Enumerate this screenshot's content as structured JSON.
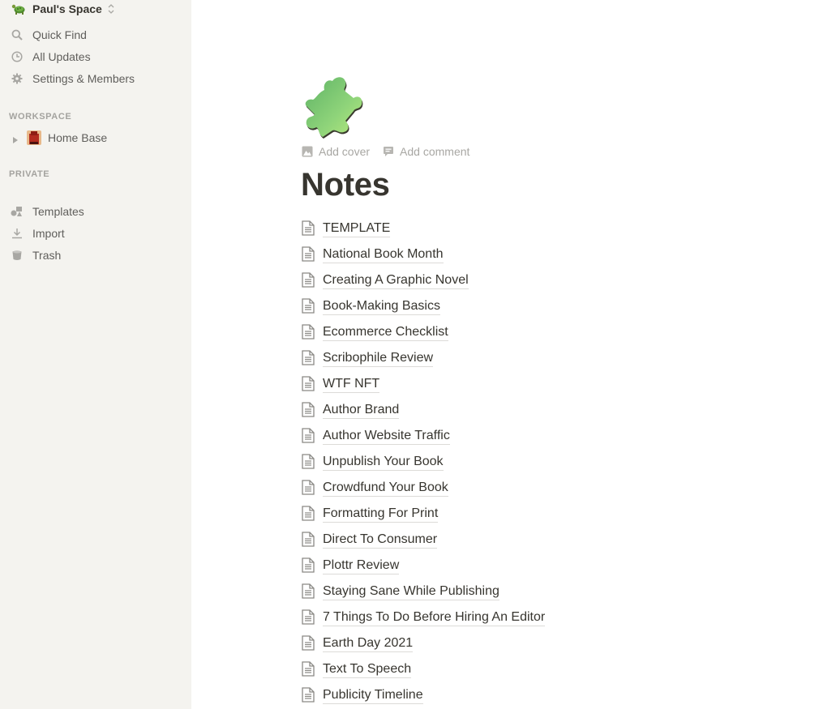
{
  "sidebar": {
    "workspace_name": "Paul's Space",
    "workspace_icon": "turtle-icon",
    "nav": [
      {
        "label": "Quick Find",
        "icon": "search-icon"
      },
      {
        "label": "All Updates",
        "icon": "clock-icon"
      },
      {
        "label": "Settings & Members",
        "icon": "gear-icon"
      }
    ],
    "sections": {
      "workspace_label": "WORKSPACE",
      "private_label": "PRIVATE"
    },
    "workspace_pages": [
      {
        "label": "Home Base",
        "icon": "page-emoji-icon",
        "expanded": false
      }
    ],
    "footer_nav": [
      {
        "label": "Templates",
        "icon": "templates-icon"
      },
      {
        "label": "Import",
        "icon": "import-icon"
      },
      {
        "label": "Trash",
        "icon": "trash-icon"
      }
    ]
  },
  "page": {
    "icon": "puzzle-piece-icon",
    "actions": {
      "add_cover": "Add cover",
      "add_comment": "Add comment"
    },
    "title": "Notes",
    "subpages": [
      "TEMPLATE",
      "National Book Month",
      "Creating A Graphic Novel",
      "Book-Making Basics",
      "Ecommerce Checklist",
      "Scribophile Review",
      "WTF NFT",
      "Author Brand",
      "Author Website Traffic",
      "Unpublish Your Book",
      "Crowdfund Your Book",
      "Formatting For Print",
      "Direct To Consumer",
      "Plottr Review",
      "Staying Sane While Publishing",
      "7 Things To Do Before Hiring An Editor",
      "Earth Day 2021",
      "Text To Speech",
      "Publicity Timeline"
    ]
  },
  "colors": {
    "sidebar_bg": "#f4f3ef",
    "text_primary": "#37352f",
    "text_secondary": "#5f5e5b",
    "text_muted": "#a8a7a3"
  }
}
